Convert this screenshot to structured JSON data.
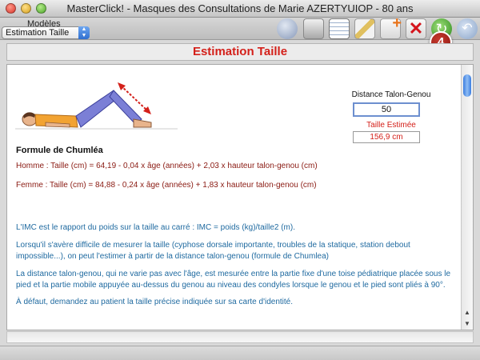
{
  "window": {
    "title": "MasterClick! - Masques des Consultations de Marie AZERTYUIOP - 80 ans"
  },
  "toolbar": {
    "modeles_label": "Modèles",
    "modeles_value": "Estimation Taille",
    "step_badge": "4",
    "icons": [
      "globe-icon",
      "printer-icon",
      "table-icon",
      "pencil-icon",
      "add-document-icon",
      "delete-icon",
      "refresh-icon",
      "back-icon"
    ]
  },
  "page": {
    "heading": "Estimation Taille"
  },
  "form": {
    "distance_label": "Distance Talon-Genou",
    "distance_value": "50",
    "estimate_label": "Taille Estimée",
    "estimate_value": "156,9 cm"
  },
  "content": {
    "formula_heading": "Formule de Chumléa",
    "formula_homme": "Homme : Taille (cm) = 64,19 - 0,04 x âge (années) + 2,03 x hauteur talon-genou (cm)",
    "formula_femme": "Femme : Taille (cm) = 84,88 - 0,24 x âge (années) + 1,83 x hauteur talon-genou (cm)",
    "para_imc": "L'IMC est le rapport du poids sur la taille au carré : IMC = poids (kg)/taille2 (m).",
    "para_difficile": "Lorsqu'il s'avère difficile de mesurer la taille (cyphose dorsale importante, troubles de la statique, station debout impossible...), on peut l'estimer à partir de la distance talon-genou (formule de Chumlea)",
    "para_mesure": "La distance talon-genou, qui ne varie pas avec l'âge, est mesurée entre la partie fixe d'une toise pédiatrique placée sous le pied et la partie mobile appuyée au-dessus du genou au niveau des condyles lorsque le genou et le pied sont pliés à 90°.",
    "para_defaut": "À défaut, demandez au patient la taille précise indiquée sur sa carte d'identité."
  },
  "colors": {
    "accent_red": "#d4201a",
    "formula_text": "#8a1a12",
    "paragraph_text": "#1f6aa0",
    "scroll_blue": "#3b7ee0"
  }
}
